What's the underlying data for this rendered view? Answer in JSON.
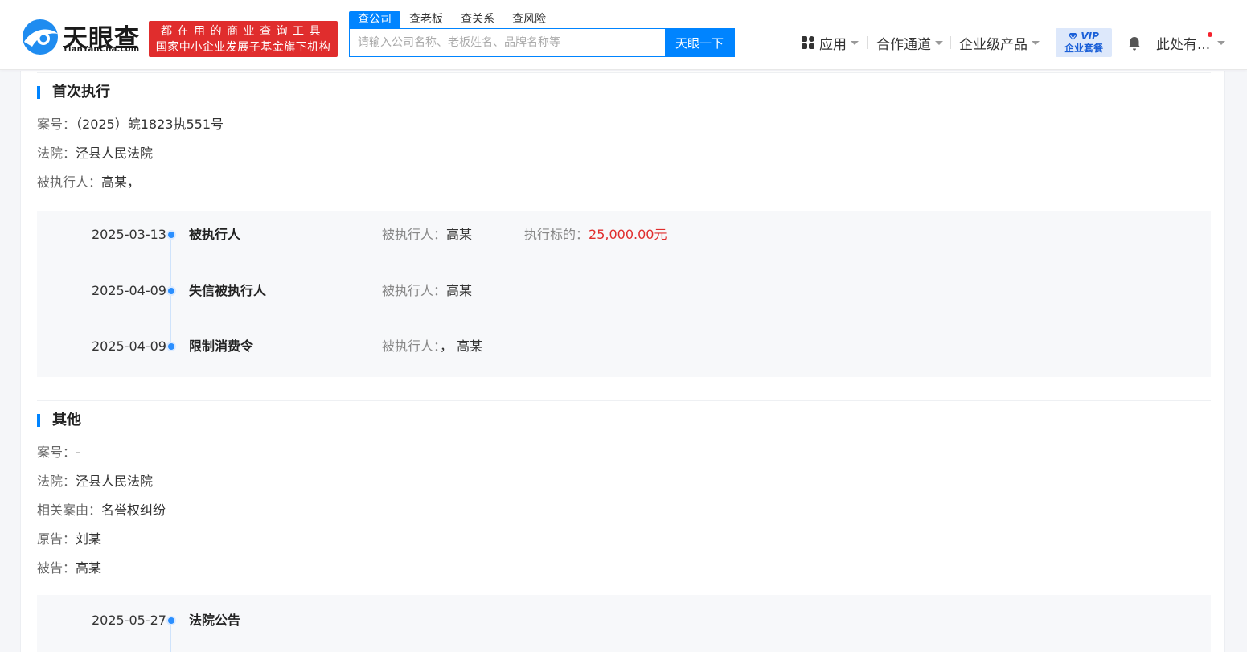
{
  "header": {
    "logo_cn": "天眼查",
    "logo_en": "TianYanCha.com",
    "slogan_line1": "都在用的商业查询工具",
    "slogan_line2": "国家中小企业发展子基金旗下机构",
    "search_tabs": [
      "查公司",
      "查老板",
      "查关系",
      "查风险"
    ],
    "search_placeholder": "请输入公司名称、老板姓名、品牌名称等",
    "search_button": "天眼一下",
    "nav": {
      "apps": "应用",
      "channel": "合作通道",
      "enterprise": "企业级产品"
    },
    "vip_line1": "VIP",
    "vip_line2": "企业套餐",
    "user_name": "此处有..."
  },
  "sections": [
    {
      "title": "首次执行",
      "fields": [
        {
          "key": "案号：",
          "value": "（2025）皖1823执551号"
        },
        {
          "key": "法院：",
          "value": "泾县人民法院"
        },
        {
          "key": "被执行人：",
          "value": "高某，"
        }
      ],
      "timeline": [
        {
          "date": "2025-03-13",
          "type": "被执行人",
          "party_key": "被执行人：",
          "party_value": "高某",
          "amount_key": "执行标的：",
          "amount_value": "25,000.00元"
        },
        {
          "date": "2025-04-09",
          "type": "失信被执行人",
          "party_key": "被执行人：",
          "party_value": "高某"
        },
        {
          "date": "2025-04-09",
          "type": "限制消费令",
          "party_key": "被执行人：",
          "party_value": "，  高某"
        }
      ]
    },
    {
      "title": "其他",
      "fields": [
        {
          "key": "案号：",
          "value": "-"
        },
        {
          "key": "法院：",
          "value": "泾县人民法院"
        },
        {
          "key": "相关案由：",
          "value": "名誉权纠纷"
        },
        {
          "key": "原告：",
          "value": "刘某"
        },
        {
          "key": "被告：",
          "value": "高某"
        }
      ],
      "timeline": [
        {
          "date": "2025-05-27",
          "type": "法院公告"
        }
      ]
    }
  ],
  "colors": {
    "brand_blue": "#0084ff",
    "slogan_red": "#e02d2d",
    "amount_red": "#e02d2d"
  }
}
